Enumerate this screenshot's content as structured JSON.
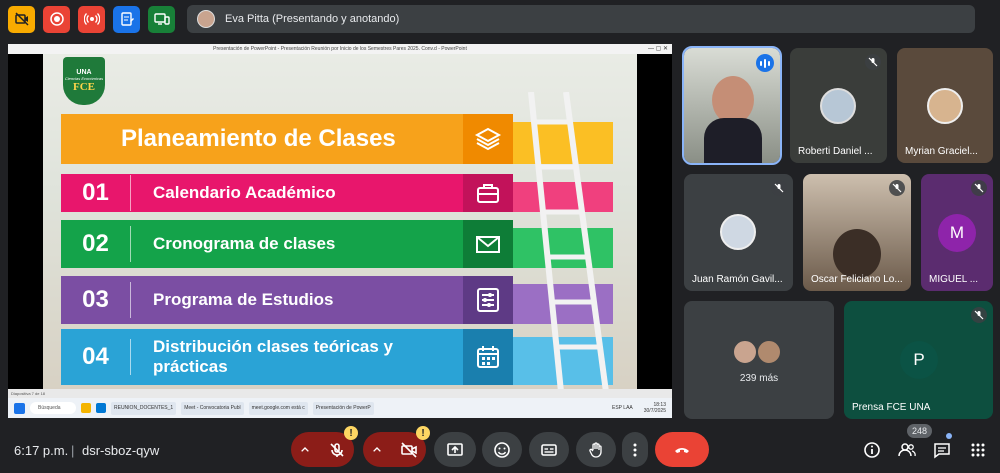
{
  "top_toolbar": {
    "buttons": [
      {
        "name": "no-camera-icon",
        "color": "#f9ab00"
      },
      {
        "name": "record-icon",
        "color": "#ea4335"
      },
      {
        "name": "live-stream-icon",
        "color": "#ea4335"
      },
      {
        "name": "notes-icon",
        "color": "#1a73e8"
      },
      {
        "name": "companion-screen-icon",
        "color": "#188038"
      }
    ],
    "presenter_label": "Eva Pitta (Presentando y anotando)"
  },
  "shared_screen": {
    "window_title": "Presentación de PowerPoint - Presentación Reunión por Inicio de los Semestres Pares 2025. Conv.d - PowerPoint",
    "slide": {
      "logo_top": "UNA",
      "logo_sub": "Ciencias Económicas",
      "logo_main": "FCE",
      "title": "Planeamiento de Clases",
      "items": [
        {
          "num": "01",
          "label": "Calendario Académico",
          "icon": "briefcase-icon"
        },
        {
          "num": "02",
          "label": "Cronograma de clases",
          "icon": "envelope-icon"
        },
        {
          "num": "03",
          "label": "Programa de Estudios",
          "icon": "sliders-icon"
        },
        {
          "num": "04",
          "label": "Distribución clases teóricas y prácticas",
          "icon": "calendar-icon"
        }
      ],
      "title_icon": "layers-icon"
    },
    "status_bar": "Diapositiva 7 de 18",
    "taskbar": {
      "search": "Búsqueda",
      "items": [
        "REUNION_DOCENTES_1",
        "Meet - Convocatoria Publ",
        "meet.google.com está c",
        "Presentación de PowerP"
      ],
      "tray_lang": "ESP LAA",
      "tray_time": "18:13",
      "tray_date": "30/7/2025"
    }
  },
  "participants": [
    {
      "name": "",
      "speaking": true
    },
    {
      "name": "Roberti Daniel ...",
      "muted": true
    },
    {
      "name": "Myrian Graciel...",
      "muted": false
    },
    {
      "name": "Juan Ramón Gavil...",
      "muted": true
    },
    {
      "name": "Oscar Feliciano Lo...",
      "muted": true
    },
    {
      "name": "MIGUEL ...",
      "initial": "M",
      "muted": true,
      "avatar_color": "#8e24aa"
    },
    {
      "name": "",
      "more_label": "239 más"
    },
    {
      "name": "Prensa FCE UNA",
      "initial": "P",
      "muted": true,
      "avatar_color": "#0b5345"
    }
  ],
  "bottom_bar": {
    "time": "6:17 p.m.",
    "separator": "|",
    "meeting_code": "dsr-sboz-qyw",
    "warning_mark": "!",
    "participant_count": "248"
  }
}
